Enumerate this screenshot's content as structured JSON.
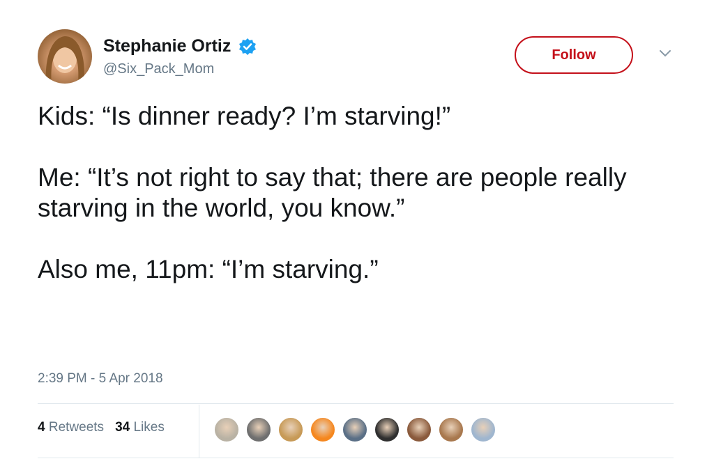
{
  "author": {
    "display_name": "Stephanie Ortiz",
    "handle": "@Six_Pack_Mom",
    "verified": true,
    "avatar_icon": "avatar"
  },
  "actions": {
    "follow_label": "Follow",
    "caret_icon": "chevron-down-icon"
  },
  "tweet": {
    "paragraphs": [
      "Kids: “Is dinner ready? I’m starving!”",
      "Me: “It’s not right to say that; there are people really starving in the world, you know.”",
      "Also me, 11pm: “I’m starving.”"
    ],
    "timestamp": "2:39 PM - 5 Apr 2018"
  },
  "stats": {
    "retweets_count": "4",
    "retweets_label": "Retweets",
    "likes_count": "34",
    "likes_label": "Likes"
  },
  "likers": [
    {
      "name": "liker-avatar-1",
      "color": "#b9b2a4"
    },
    {
      "name": "liker-avatar-2",
      "color": "#6f6f6f"
    },
    {
      "name": "liker-avatar-3",
      "color": "#c79a57"
    },
    {
      "name": "liker-avatar-4",
      "color": "#f5871f"
    },
    {
      "name": "liker-avatar-5",
      "color": "#5a6f86"
    },
    {
      "name": "liker-avatar-6",
      "color": "#2f2f2f"
    },
    {
      "name": "liker-avatar-7",
      "color": "#8a5a3c"
    },
    {
      "name": "liker-avatar-8",
      "color": "#a8784e"
    },
    {
      "name": "liker-avatar-9",
      "color": "#9fb6cf"
    }
  ],
  "colors": {
    "follow_accent": "#c4101a",
    "verified_blue": "#1da1f2",
    "secondary_text": "#657786",
    "divider": "#e1e8ed"
  }
}
